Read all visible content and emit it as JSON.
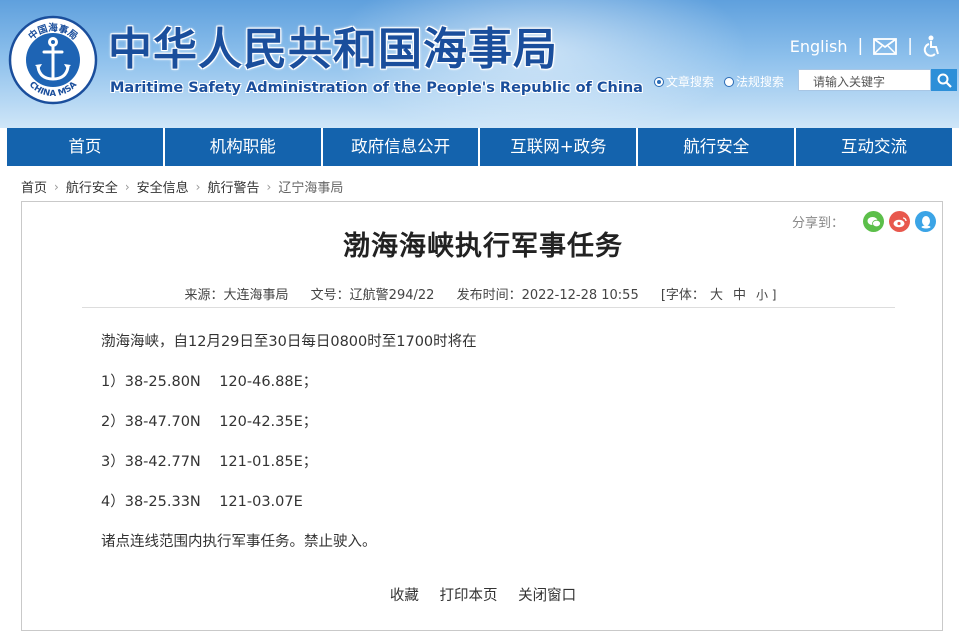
{
  "header": {
    "logo_top_text": "中国海事局",
    "logo_bottom_text": "CHINA MSA",
    "title_cn": "中华人民共和国海事局",
    "title_en": "Maritime Safety Administration of the People's Republic of China",
    "english_link": "English",
    "search_scope": {
      "article": "文章搜索",
      "regulation": "法规搜索",
      "selected": "文章搜索"
    },
    "search_placeholder": "请输入关键字"
  },
  "nav": {
    "items": [
      {
        "label": "首页"
      },
      {
        "label": "机构职能"
      },
      {
        "label": "政府信息公开"
      },
      {
        "label": "互联网+政务"
      },
      {
        "label": "航行安全"
      },
      {
        "label": "互动交流"
      }
    ]
  },
  "breadcrumb": [
    "首页",
    "航行安全",
    "安全信息",
    "航行警告",
    "辽宁海事局"
  ],
  "article": {
    "share_label": "分享到：",
    "title": "渤海海峡执行军事任务",
    "source": "来源：大连海事局",
    "doc_no": "文号：辽航警294/22",
    "publish_time": "发布时间：2022-12-28 10:55",
    "font_size_label": "[字体：",
    "font_large": "大",
    "font_medium": "中",
    "font_small": "小 ]",
    "paragraphs": [
      "渤海海峡，自12月29日至30日每日0800时至1700时将在",
      "1）38-25.80N    120-46.88E；",
      "2）38-47.70N    120-42.35E；",
      "3）38-42.77N    121-01.85E；",
      "4）38-25.33N    121-03.07E",
      "诸点连线范围内执行军事任务。禁止驶入。"
    ],
    "actions": {
      "favorite": "收藏",
      "print": "打印本页",
      "close": "关闭窗口"
    }
  },
  "colors": {
    "nav_bg": "#1463ad",
    "title_blue": "#1a4e9c",
    "search_button": "#2d8fd8"
  },
  "icons": [
    "anchor-emblem-icon",
    "mail-icon",
    "accessibility-icon",
    "search-icon",
    "wechat-icon",
    "weibo-icon",
    "qq-icon"
  ]
}
